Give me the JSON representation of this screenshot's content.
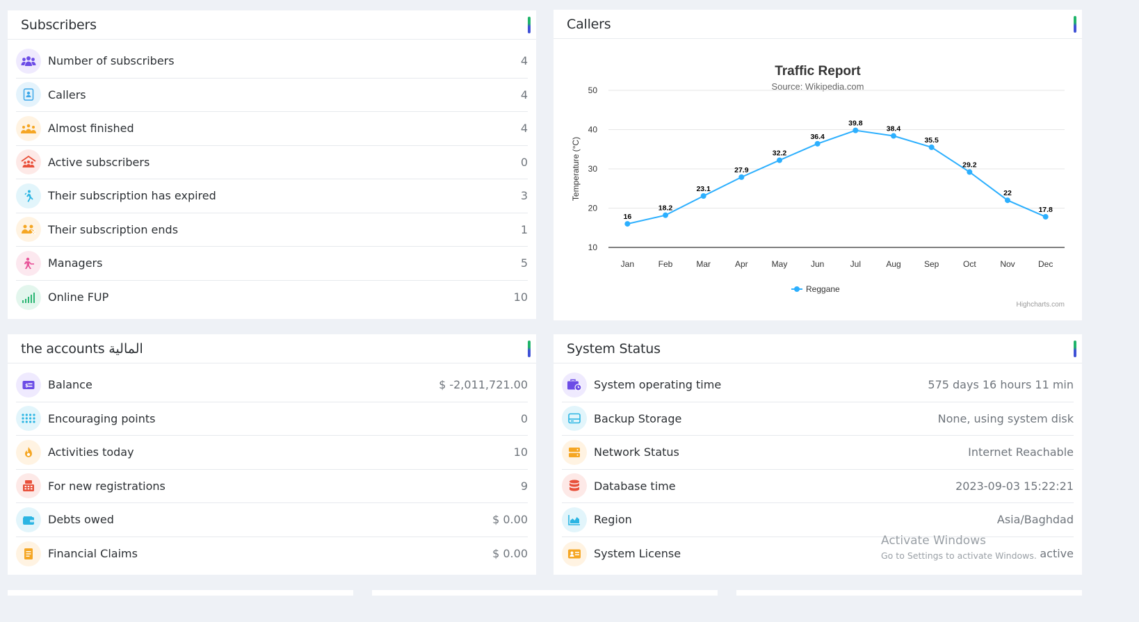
{
  "subscribers": {
    "title": "Subscribers",
    "items": [
      {
        "label": "Number of subscribers",
        "value": "4",
        "icon": "users-group-icon"
      },
      {
        "label": "Callers",
        "value": "4",
        "icon": "contact-card-icon"
      },
      {
        "label": "Almost finished",
        "value": "4",
        "icon": "crowd-icon"
      },
      {
        "label": "Active subscribers",
        "value": "0",
        "icon": "active-users-icon"
      },
      {
        "label": "Their subscription has expired",
        "value": "3",
        "icon": "walking-person-icon"
      },
      {
        "label": "Their subscription ends",
        "value": "1",
        "icon": "users-remove-icon"
      },
      {
        "label": "Managers",
        "value": "5",
        "icon": "manager-icon"
      },
      {
        "label": "Online FUP",
        "value": "10",
        "icon": "signal-bars-icon"
      }
    ]
  },
  "callers": {
    "title": "Callers"
  },
  "chart_data": {
    "type": "line",
    "title": "Traffic Report",
    "subtitle": "Source: Wikipedia.com",
    "ylabel": "Temperature (°C)",
    "xlabel": "",
    "categories": [
      "Jan",
      "Feb",
      "Mar",
      "Apr",
      "May",
      "Jun",
      "Jul",
      "Aug",
      "Sep",
      "Oct",
      "Nov",
      "Dec"
    ],
    "yticks": [
      "10",
      "20",
      "30",
      "40",
      "50"
    ],
    "ylim": [
      10,
      50
    ],
    "series": [
      {
        "name": "Reggane",
        "values": [
          16,
          18.2,
          23.1,
          27.9,
          32.2,
          36.4,
          39.8,
          38.4,
          35.5,
          29.2,
          22,
          17.8
        ],
        "color": "#2caffe"
      }
    ],
    "data_labels": [
      "16",
      "18.2",
      "23.1",
      "27.9",
      "32.2",
      "36.4",
      "39.8",
      "38.4",
      "35.5",
      "29.2",
      "22",
      "17.8"
    ],
    "legend_position": "bottom",
    "grid": true,
    "credits": "Highcharts.com"
  },
  "accounts": {
    "title": "the accounts المالية",
    "items": [
      {
        "label": "Balance",
        "value": "$ -2,011,721.00",
        "icon": "money-icon"
      },
      {
        "label": "Encouraging points",
        "value": "0",
        "icon": "dots-grid-icon"
      },
      {
        "label": "Activities today",
        "value": "10",
        "icon": "fire-icon"
      },
      {
        "label": "For new registrations",
        "value": "9",
        "icon": "cash-register-icon"
      },
      {
        "label": "Debts owed",
        "value": "$ 0.00",
        "icon": "wallet-icon"
      },
      {
        "label": "Financial Claims",
        "value": "$ 0.00",
        "icon": "document-icon"
      }
    ]
  },
  "system": {
    "title": "System Status",
    "items": [
      {
        "label": "System operating time",
        "value": "575 days 16 hours 11 min",
        "icon": "briefcase-clock-icon"
      },
      {
        "label": "Backup Storage",
        "value": "None, using system disk",
        "icon": "storage-icon"
      },
      {
        "label": "Network Status",
        "value": "Internet Reachable",
        "icon": "server-icon"
      },
      {
        "label": "Database time",
        "value": "2023-09-03 15:22:21",
        "icon": "database-icon"
      },
      {
        "label": "Region",
        "value": "Asia/Baghdad",
        "icon": "area-chart-icon"
      },
      {
        "label": "System License",
        "value": "active",
        "icon": "id-card-icon"
      }
    ]
  },
  "watermark": {
    "line1": "Activate Windows",
    "line2": "Go to Settings to activate Windows."
  }
}
